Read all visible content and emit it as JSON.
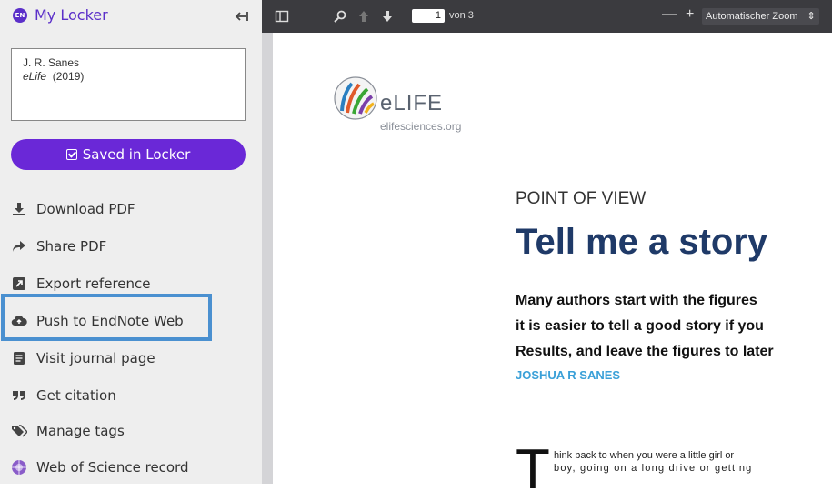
{
  "sidebar": {
    "badge": "EN",
    "title": "My Locker",
    "reference": {
      "author": "J. R. Sanes",
      "journal": "eLife",
      "year": "(2019)"
    },
    "saved_label": "Saved in Locker",
    "items": [
      {
        "label": "Download PDF",
        "icon": "download-icon"
      },
      {
        "label": "Share PDF",
        "icon": "share-arrow-icon"
      },
      {
        "label": "Export reference",
        "icon": "export-icon"
      },
      {
        "label": "Push to EndNote Web",
        "icon": "cloud-upload-icon"
      },
      {
        "label": "Visit journal page",
        "icon": "document-icon"
      },
      {
        "label": "Get citation",
        "icon": "quote-icon"
      },
      {
        "label": "Manage tags",
        "icon": "tag-icon"
      },
      {
        "label": "Web of Science record",
        "icon": "web-of-science-icon"
      }
    ],
    "highlight_color": "#4a90d0",
    "accent_color": "#6a28d7"
  },
  "viewer": {
    "page_number": "1",
    "page_of": "von 3",
    "zoom_label": "Automatischer Zoom",
    "zoom_minus": "—",
    "zoom_plus": "+"
  },
  "document": {
    "logo_text": "eLIFE",
    "logo_sub": "elifesciences.org",
    "kicker": "POINT OF VIEW",
    "title": "Tell me a story",
    "abstract_lines": [
      "Many authors start with the figures",
      "it is easier to tell a good story if you",
      "Results, and leave the figures to later"
    ],
    "author": "JOSHUA R SANES",
    "dropcap": "T",
    "body_lines": [
      "hink back to when you were a little girl or",
      "boy, going on a long drive or getting"
    ]
  }
}
